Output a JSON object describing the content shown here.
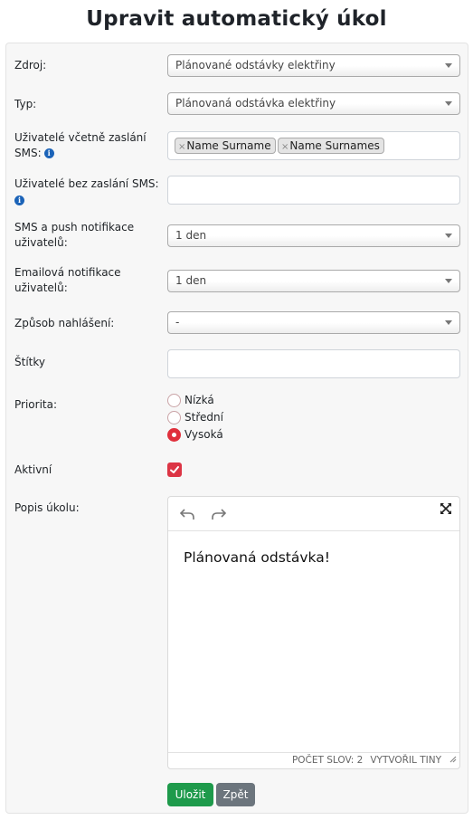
{
  "page": {
    "title": "Upravit automatický úkol"
  },
  "form": {
    "source": {
      "label": "Zdroj:",
      "value": "Plánované odstávky elektřiny"
    },
    "type": {
      "label": "Typ:",
      "value": "Plánovaná odstávka elektřiny"
    },
    "users_sms": {
      "label": "Uživatelé včetně zaslání SMS:",
      "tags": [
        "Name Surname",
        "Name Surnames"
      ],
      "info_icon": "info-icon"
    },
    "users_no_sms": {
      "label": "Uživatelé bez zaslání SMS:",
      "value": "",
      "info_icon": "info-icon"
    },
    "sms_push": {
      "label": "SMS a push notifikace uživatelů:",
      "value": "1 den"
    },
    "email_notify": {
      "label": "Emailová notifikace uživatelů:",
      "value": "1 den"
    },
    "report_method": {
      "label": "Způsob nahlášení:",
      "value": "-"
    },
    "tags": {
      "label": "Štítky",
      "value": ""
    },
    "priority": {
      "label": "Priorita:",
      "options": [
        "Nízká",
        "Střední",
        "Vysoká"
      ],
      "selected": "Vysoká"
    },
    "active": {
      "label": "Aktivní",
      "checked": true
    },
    "description": {
      "label": "Popis úkolu:",
      "content": "Plánovaná odstávka!",
      "word_count_label": "Počet slov: 2",
      "branding": "Vytvořil Tiny",
      "toolbar_icons": [
        "undo-icon",
        "redo-icon",
        "fullscreen-icon"
      ]
    }
  },
  "buttons": {
    "save": "Uložit",
    "back": "Zpět"
  },
  "colors": {
    "accent": "#dc3545",
    "save": "#1e9a4b",
    "back": "#6c757d",
    "info": "#1b63b8"
  }
}
